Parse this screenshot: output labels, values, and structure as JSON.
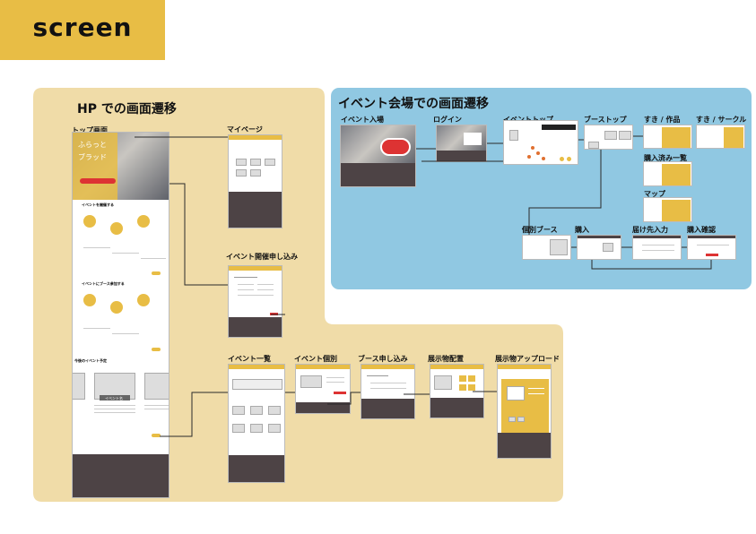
{
  "header": {
    "title": "screen"
  },
  "hp_section": {
    "title": "HP での画面遷移",
    "screens": {
      "top": "トップ画面",
      "mypage": "マイページ",
      "event_apply": "イベント開催申し込み",
      "event_list": "イベント一覧",
      "event_detail": "イベント個別",
      "booth_apply": "ブース申し込み",
      "exhibit_layout": "展示物配置",
      "exhibit_upload": "展示物アップロード"
    },
    "top_texts": {
      "hero_line1": "ふらっと",
      "hero_line2": "ブラッド",
      "host_heading": "イベントを開催する",
      "booth_heading": "イベントにブース参加する",
      "upcoming": "今後のイベント予定",
      "event_tag": "イベント名"
    }
  },
  "venue_section": {
    "title": "イベント会場での画面遷移",
    "screens": {
      "entry": "イベント入場",
      "login": "ログイン",
      "event_top": "イベントトップ",
      "booth_top": "ブーストップ",
      "fav_work": "すき / 作品",
      "fav_circle": "すき / サークル",
      "purchase_list": "購入済み一覧",
      "map": "マップ",
      "booth": "個別ブース",
      "purchase": "購入",
      "delivery": "届け先入力",
      "confirm": "購入確認"
    }
  },
  "colors": {
    "accent": "#e8bd45",
    "hp_bg": "#f0dca8",
    "venue_bg": "#90c8e2",
    "footer": "#4d4345",
    "link": "#d33"
  }
}
